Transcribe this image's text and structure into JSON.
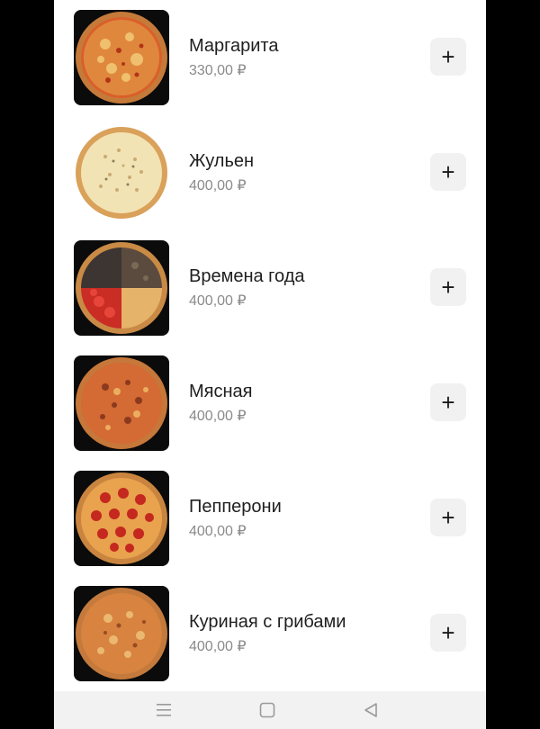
{
  "menu": {
    "items": [
      {
        "name": "Маргарита",
        "price": "330,00 ₽",
        "add_label": "+",
        "image": "pizza-margherita",
        "bg": "dark"
      },
      {
        "name": "Жульен",
        "price": "400,00 ₽",
        "add_label": "+",
        "image": "pizza-julienne",
        "bg": "white"
      },
      {
        "name": "Времена года",
        "price": "400,00 ₽",
        "add_label": "+",
        "image": "pizza-four-seasons",
        "bg": "dark"
      },
      {
        "name": "Мясная",
        "price": "400,00 ₽",
        "add_label": "+",
        "image": "pizza-meat",
        "bg": "dark"
      },
      {
        "name": "Пепперони",
        "price": "400,00 ₽",
        "add_label": "+",
        "image": "pizza-pepperoni",
        "bg": "dark"
      },
      {
        "name": "Куриная с грибами",
        "price": "400,00 ₽",
        "add_label": "+",
        "image": "pizza-chicken-mushroom",
        "bg": "dark"
      }
    ]
  },
  "navbar": {
    "buttons": [
      "menu-icon",
      "home-icon",
      "back-icon"
    ]
  },
  "colors": {
    "background": "#ffffff",
    "outer": "#000000",
    "add_button_bg": "#f1f1f1",
    "price_text": "#8a8a8a",
    "navbar_bg": "#f2f2f2"
  }
}
